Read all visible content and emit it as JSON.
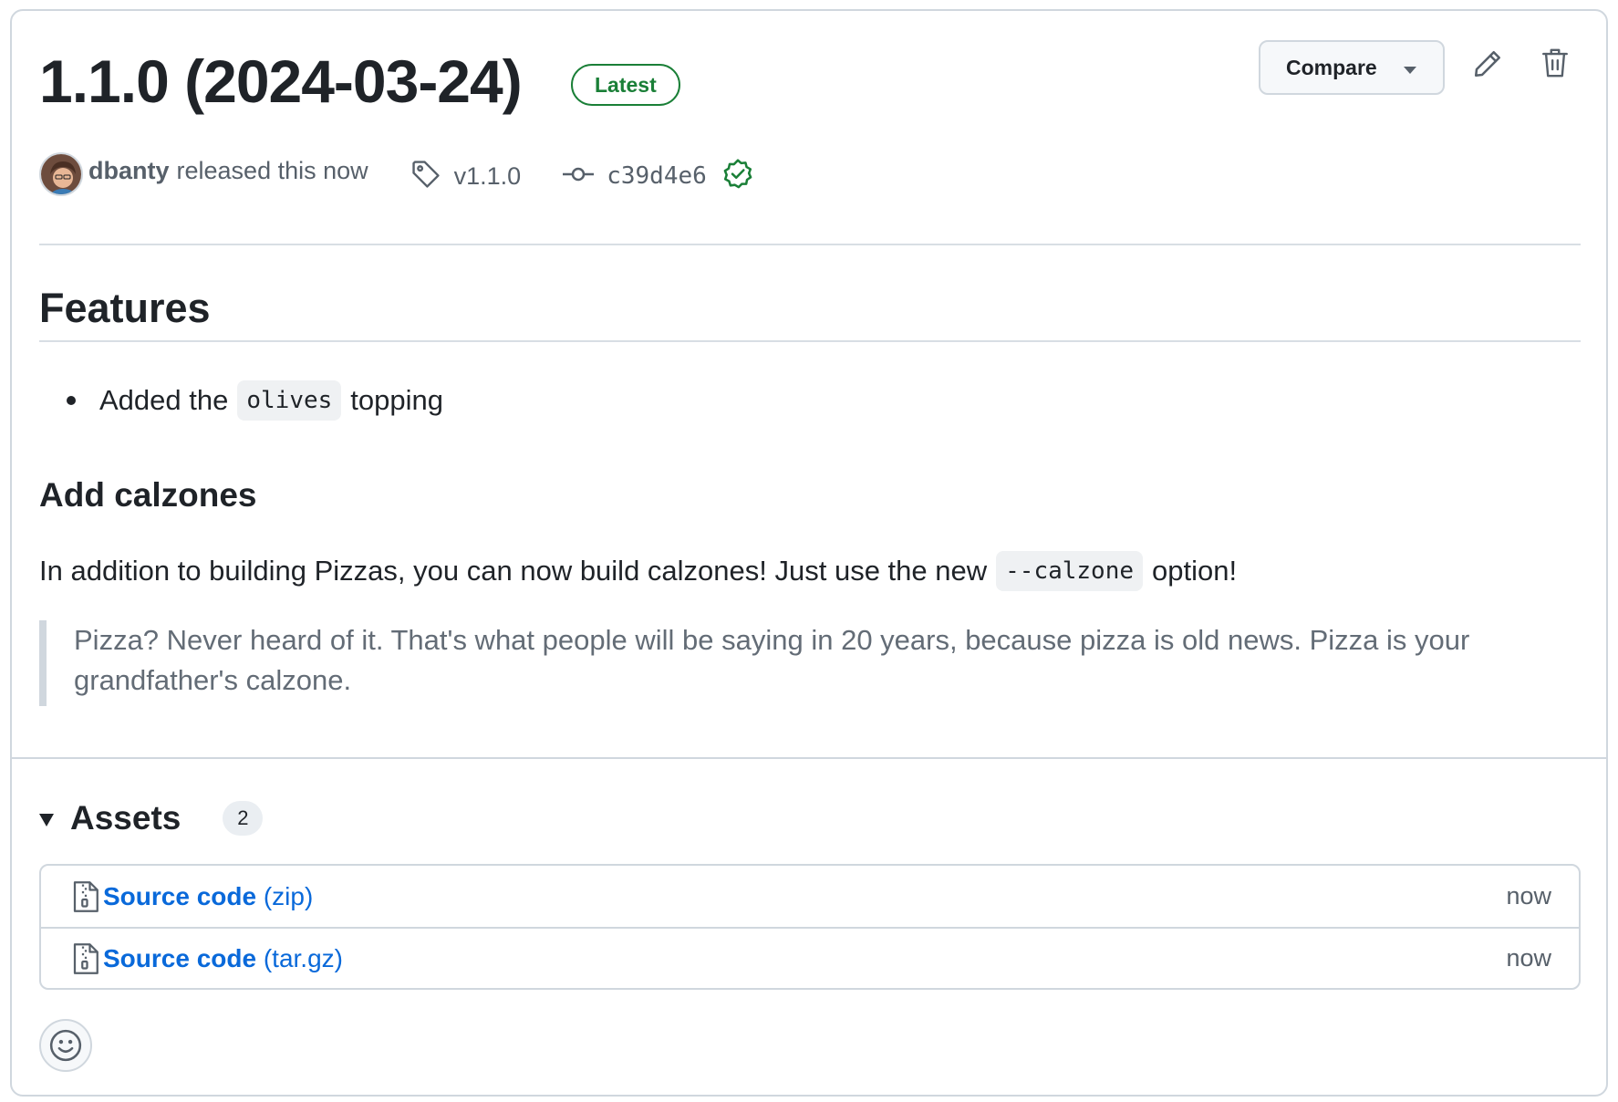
{
  "release": {
    "title": "1.1.0 (2024-03-24)",
    "badge": "Latest",
    "author": "dbanty",
    "released_text": "released this now",
    "tag": "v1.1.0",
    "commit": "c39d4e6"
  },
  "actions": {
    "compare_label": "Compare",
    "edit_icon": "pencil-icon",
    "delete_icon": "trash-icon"
  },
  "notes": {
    "features_heading": "Features",
    "feature_item": {
      "before": "Added the",
      "code": "olives",
      "after": "topping"
    },
    "calzones_heading": "Add calzones",
    "paragraph": {
      "before": "In addition to building Pizzas, you can now build calzones! Just use the new",
      "code": "--calzone",
      "after": "option!"
    },
    "quote": "Pizza? Never heard of it. That's what people will be saying in 20 years, because pizza is old news. Pizza is your grandfather's calzone."
  },
  "assets": {
    "title": "Assets",
    "count": "2",
    "items": [
      {
        "name": "Source code",
        "ext": "(zip)",
        "time": "now"
      },
      {
        "name": "Source code",
        "ext": "(tar.gz)",
        "time": "now"
      }
    ]
  },
  "colors": {
    "accent_link": "#0969da",
    "success_green": "#1a7f37",
    "border": "#d0d7de",
    "muted_text": "#57606a"
  }
}
